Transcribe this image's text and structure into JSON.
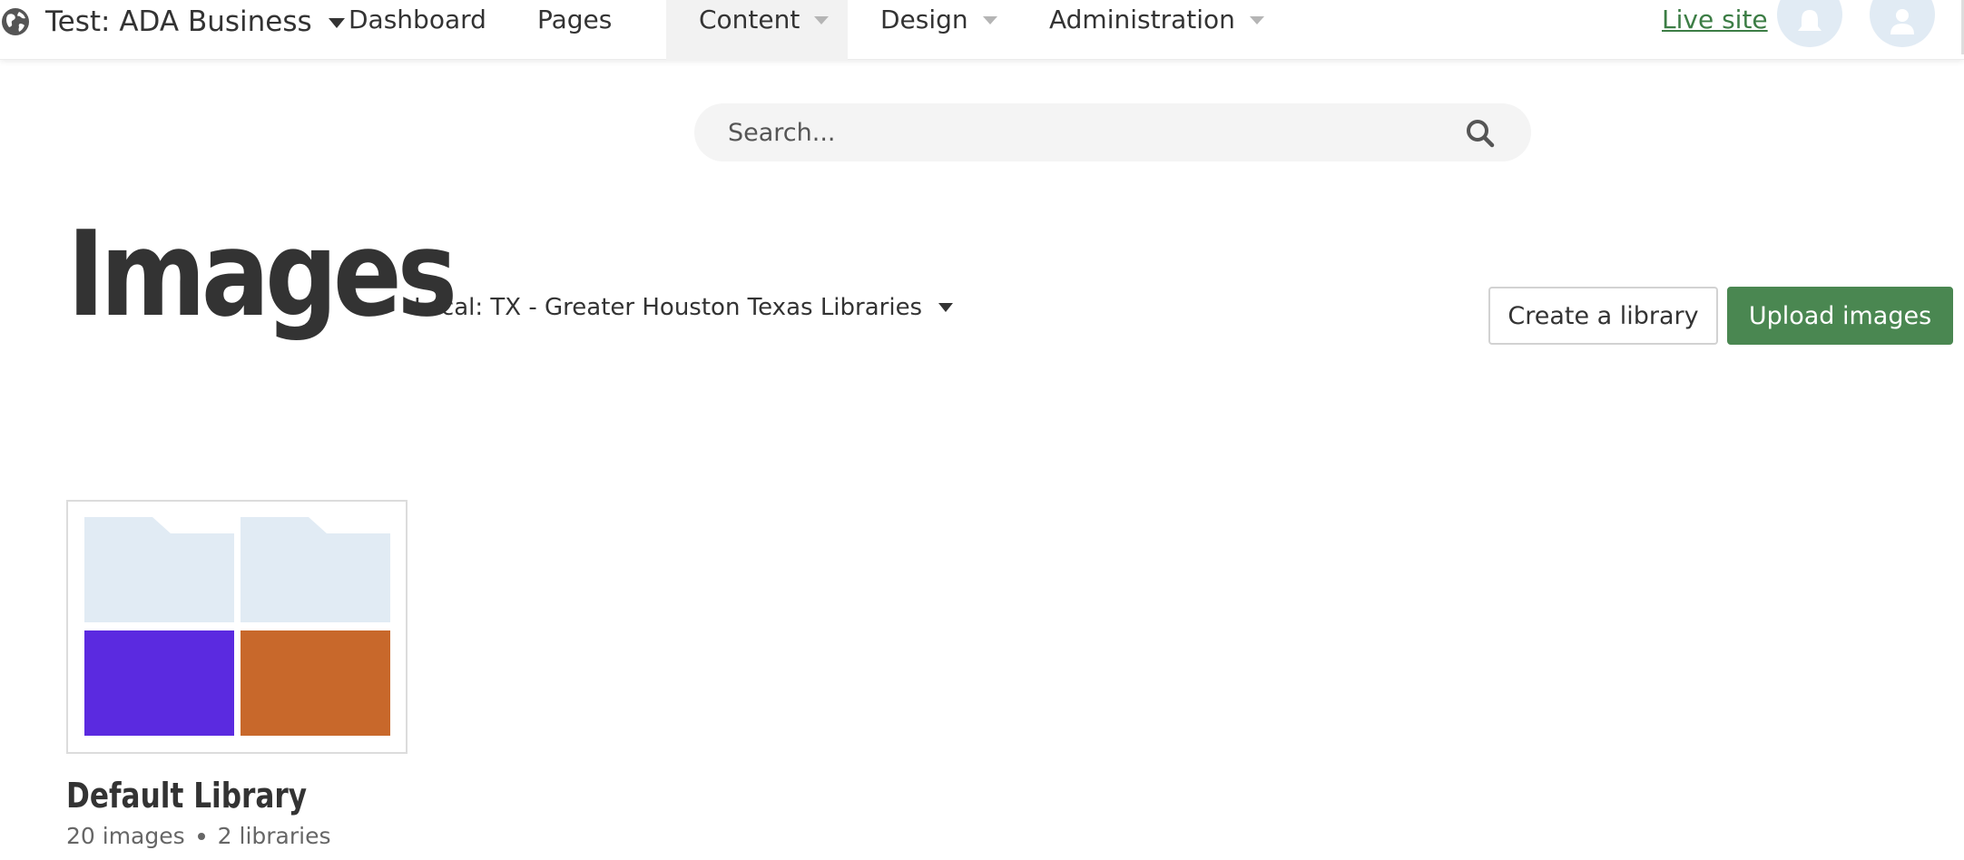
{
  "header": {
    "site_name": "Test: ADA Business",
    "nav": [
      {
        "label": "Dashboard",
        "has_menu": false
      },
      {
        "label": "Pages",
        "has_menu": false
      },
      {
        "label": "Content",
        "has_menu": true,
        "active": true
      },
      {
        "label": "Design",
        "has_menu": true
      },
      {
        "label": "Administration",
        "has_menu": true
      }
    ],
    "live_site_label": "Live site",
    "icons": {
      "site": "globe-icon",
      "notifications": "bell-icon",
      "account": "user-icon"
    }
  },
  "search": {
    "placeholder": "Search...",
    "icon": "search-icon"
  },
  "page": {
    "title": "Images",
    "location": "Local: TX - Greater Houston Texas Libraries",
    "create_button": "Create a library",
    "upload_button": "Upload images"
  },
  "libraries": [
    {
      "name": "Default Library",
      "images_count": "20 images",
      "libraries_count": "2 libraries",
      "thumbnails": [
        {
          "kind": "folder",
          "color": "#e1ebf4"
        },
        {
          "kind": "folder",
          "color": "#e1ebf4"
        },
        {
          "kind": "image",
          "color": "#5b2ae0"
        },
        {
          "kind": "image",
          "color": "#c8682b"
        }
      ]
    }
  ],
  "colors": {
    "accent_green": "#4a8751",
    "link_green": "#3c7d45",
    "icon_bg": "#e1ebf4"
  }
}
